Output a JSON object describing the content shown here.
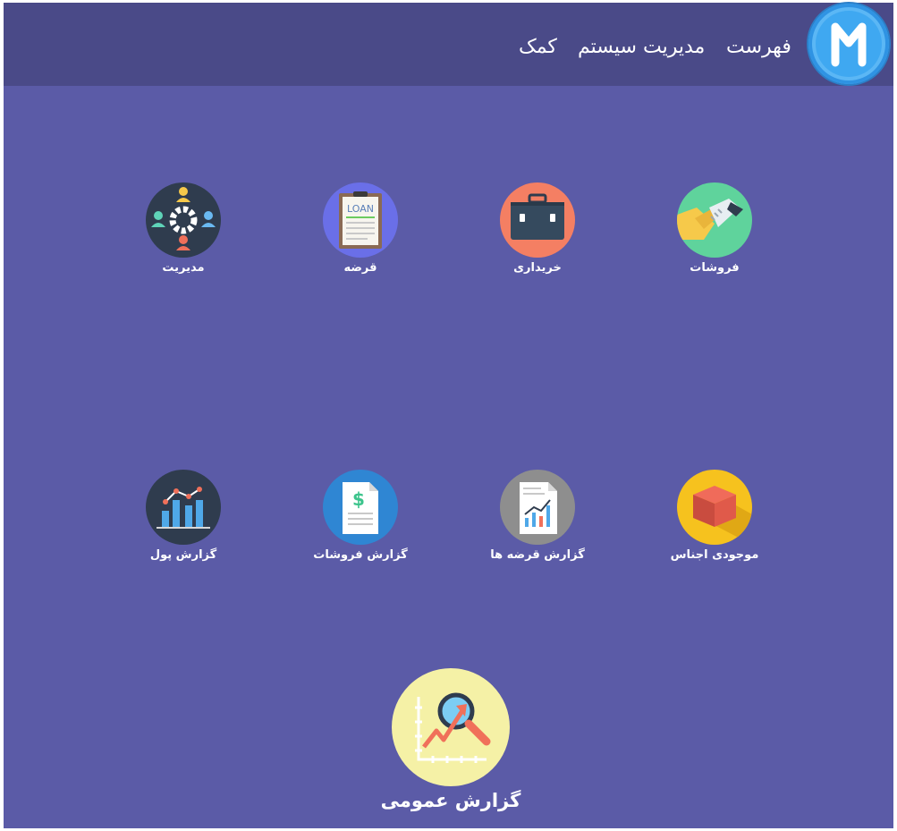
{
  "header": {
    "logo_letter": "M",
    "menu": [
      {
        "label": "فهرست"
      },
      {
        "label": "مدیریت سیستم"
      },
      {
        "label": "کمک"
      }
    ]
  },
  "tiles": [
    {
      "label": "فروشات",
      "icon": "handshake-icon",
      "color": "#5fd39c"
    },
    {
      "label": "خریداری",
      "icon": "briefcase-icon",
      "color": "#f47f63"
    },
    {
      "label": "قرضه",
      "icon": "loan-clipboard-icon",
      "color": "#6a6fe8"
    },
    {
      "label": "مدیریت",
      "icon": "team-gear-icon",
      "color": "#2f3c4e"
    },
    {
      "label": "موجودی اجناس",
      "icon": "box-icon",
      "color": "#f6c21e"
    },
    {
      "label": "گزارش قرضه ها",
      "icon": "report-chart-icon",
      "color": "#8e8e8e"
    },
    {
      "label": "گزارش فروشات",
      "icon": "dollar-document-icon",
      "color": "#2f86d3"
    },
    {
      "label": "گزارش پول",
      "icon": "bar-line-chart-icon",
      "color": "#2f3c4e"
    }
  ],
  "general_report": {
    "label": "گزارش عمومی",
    "icon": "magnifier-growth-chart-icon",
    "color": "#f5f1a6"
  }
}
